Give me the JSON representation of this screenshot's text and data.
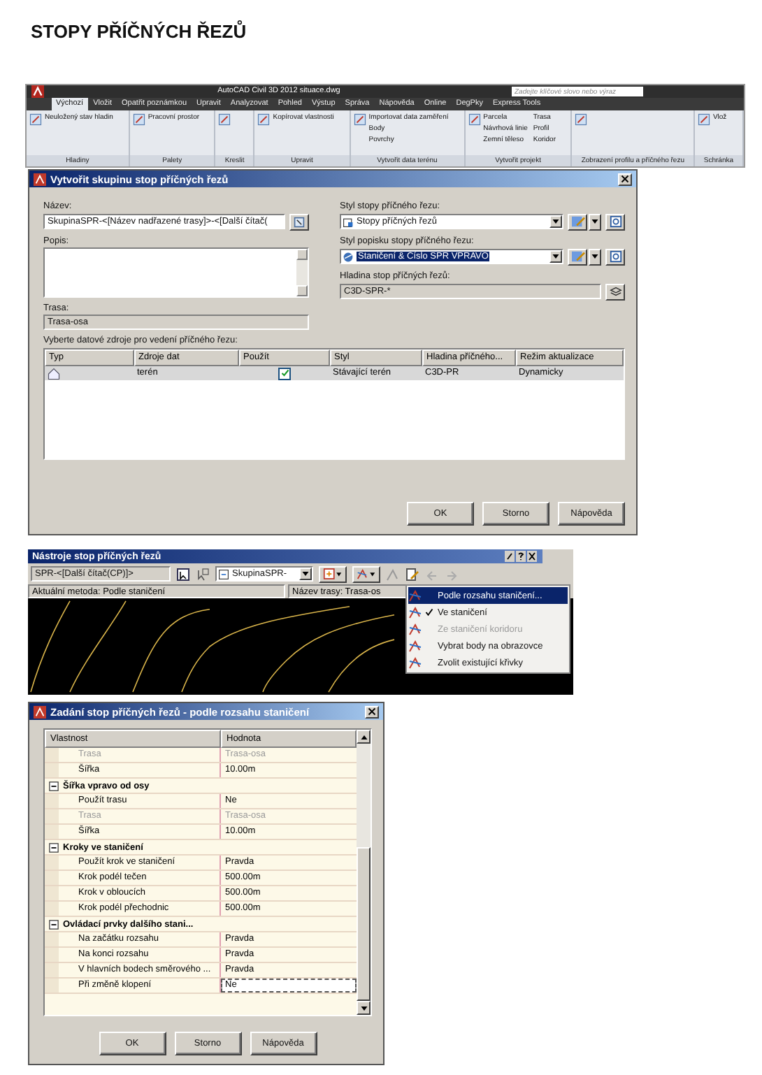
{
  "heading": "STOPY PŘÍČNÝCH ŘEZŮ",
  "ribbon": {
    "title": "AutoCAD Civil 3D 2012   situace.dwg",
    "search_placeholder": "Zadejte klíčové slovo nebo výraz",
    "tabs": [
      {
        "label": "Výchozí",
        "selected": true
      },
      {
        "label": "Vložit",
        "selected": false
      },
      {
        "label": "Opatřit poznámkou",
        "selected": false
      },
      {
        "label": "Upravit",
        "selected": false
      },
      {
        "label": "Analyzovat",
        "selected": false
      },
      {
        "label": "Pohled",
        "selected": false
      },
      {
        "label": "Výstup",
        "selected": false
      },
      {
        "label": "Správa",
        "selected": false
      },
      {
        "label": "Nápověda",
        "selected": false
      },
      {
        "label": "Online",
        "selected": false
      },
      {
        "label": "DegPky",
        "selected": false
      },
      {
        "label": "Express Tools",
        "selected": false
      }
    ],
    "panels": [
      {
        "title": "Hladiny",
        "items": [
          "Neuložený stav hladin"
        ]
      },
      {
        "title": "Palety",
        "items": [
          "Pracovní prostor"
        ]
      },
      {
        "title": "Kreslit"
      },
      {
        "title": "Upravit",
        "items": [
          "Kopírovat vlastnosti"
        ]
      },
      {
        "title": "Vytvořit data terénu",
        "items": [
          "Importovat data zaměření",
          "Body",
          "Povrchy"
        ]
      },
      {
        "title": "Vytvořit projekt",
        "items": [
          "Parcela",
          "Návrhová linie",
          "Zemní těleso",
          "Trasa",
          "Profil",
          "Koridor"
        ]
      },
      {
        "title": "Zobrazení profilu a příčného řezu"
      },
      {
        "title": "Schránka",
        "items": [
          "Vlož"
        ]
      }
    ]
  },
  "create_dialog": {
    "title": "Vytvořit skupinu stop příčných řezů",
    "name_label": "Název:",
    "name_value": "SkupinaSPR-<[Název nadřazené trasy]>-<[Další čítač(",
    "description_label": "Popis:",
    "alignment_label": "Trasa:",
    "alignment_value": "Trasa-osa",
    "style_label": "Styl stopy příčného řezu:",
    "style_value": "Stopy příčných řezů",
    "label_style_label": "Styl popisku stopy příčného řezu:",
    "label_style_value": "Staničení & Číslo SPR VPRAVO",
    "layer_label": "Hladina stop příčných řezů:",
    "layer_value": "C3D-SPR-*",
    "sources_label": "Vyberte datové zdroje pro vedení příčného řezu:",
    "columns": [
      "Typ",
      "Zdroje dat",
      "Použít",
      "Styl",
      "Hladina příčného...",
      "Režim aktualizace"
    ],
    "rows": [
      {
        "source": "terén",
        "use": true,
        "style": "Stávající terén",
        "layer": "C3D-PR",
        "update": "Dynamicky",
        "selected": true
      }
    ],
    "buttons": [
      "OK",
      "Storno",
      "Nápověda"
    ]
  },
  "tools": {
    "title": "Nástroje stop příčných řezů",
    "name_value": "SPR-<[Další čítač(CP)]>",
    "group_value": "SkupinaSPR-",
    "method_status": "Aktuální metoda: Podle staničení",
    "alignment_status": "Název trasy: Trasa-os",
    "menu": [
      {
        "label": "Podle rozsahu staničení...",
        "selected": true,
        "checked": false,
        "disabled": false
      },
      {
        "label": "Ve staničení",
        "selected": false,
        "checked": true,
        "disabled": false
      },
      {
        "label": "Ze staničení koridoru",
        "selected": false,
        "checked": false,
        "disabled": true
      },
      {
        "label": "Vybrat body na obrazovce",
        "selected": false,
        "checked": false,
        "disabled": false
      },
      {
        "label": "Zvolit existující křivky",
        "selected": false,
        "checked": false,
        "disabled": false
      }
    ]
  },
  "props_dialog": {
    "title": "Zadání stop příčných řezů - podle rozsahu staničení",
    "columns": [
      "Vlastnost",
      "Hodnota"
    ],
    "rows": [
      {
        "kind": "property",
        "name": "Trasa",
        "value": "Trasa-osa",
        "disabled": true,
        "selected": false
      },
      {
        "kind": "property",
        "name": "Šířka",
        "value": "10.00m",
        "disabled": false,
        "selected": false
      },
      {
        "kind": "category",
        "name": "Šířka vpravo od osy",
        "expanded": true
      },
      {
        "kind": "property",
        "name": "Použít trasu",
        "value": "Ne",
        "disabled": false,
        "selected": false
      },
      {
        "kind": "property",
        "name": "Trasa",
        "value": "Trasa-osa",
        "disabled": true,
        "selected": false
      },
      {
        "kind": "property",
        "name": "Šířka",
        "value": "10.00m",
        "disabled": false,
        "selected": false
      },
      {
        "kind": "category",
        "name": "Kroky ve staničení",
        "expanded": true
      },
      {
        "kind": "property",
        "name": "Použít krok ve staničení",
        "value": "Pravda",
        "disabled": false,
        "selected": false
      },
      {
        "kind": "property",
        "name": "Krok podél tečen",
        "value": "500.00m",
        "disabled": false,
        "selected": false
      },
      {
        "kind": "property",
        "name": "Krok v obloucích",
        "value": "500.00m",
        "disabled": false,
        "selected": false
      },
      {
        "kind": "property",
        "name": "Krok podél přechodnic",
        "value": "500.00m",
        "disabled": false,
        "selected": false
      },
      {
        "kind": "category",
        "name": "Ovládací prvky dalšího stani...",
        "expanded": true
      },
      {
        "kind": "property",
        "name": "Na začátku rozsahu",
        "value": "Pravda",
        "disabled": false,
        "selected": false
      },
      {
        "kind": "property",
        "name": "Na konci rozsahu",
        "value": "Pravda",
        "disabled": false,
        "selected": false
      },
      {
        "kind": "property",
        "name": "V hlavních bodech směrového ...",
        "value": "Pravda",
        "disabled": false,
        "selected": false
      },
      {
        "kind": "property",
        "name": "Při změně klopení",
        "value": "Ne",
        "disabled": false,
        "selected": true
      }
    ],
    "buttons": [
      "OK",
      "Storno",
      "Nápověda"
    ]
  }
}
